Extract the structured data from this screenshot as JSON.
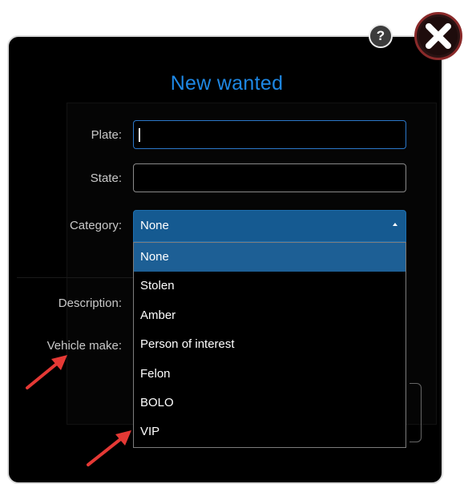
{
  "dialog": {
    "title": "New wanted",
    "help_icon": "help-icon",
    "close_icon": "close-icon"
  },
  "form": {
    "plate_label": "Plate:",
    "plate_value": "",
    "state_label": "State:",
    "state_value": "",
    "category_label": "Category:",
    "category_value": "None",
    "description_label": "Description:",
    "vehicle_make_label": "Vehicle make:"
  },
  "category_options": {
    "items": [
      "None",
      "Stolen",
      "Amber",
      "Person of interest",
      "Felon",
      "BOLO",
      "VIP"
    ],
    "selected": "None"
  },
  "colors": {
    "title": "#1e88e5",
    "select_bg": "#155a91",
    "highlight": "#1d5f95",
    "annotation": "#e53935"
  }
}
